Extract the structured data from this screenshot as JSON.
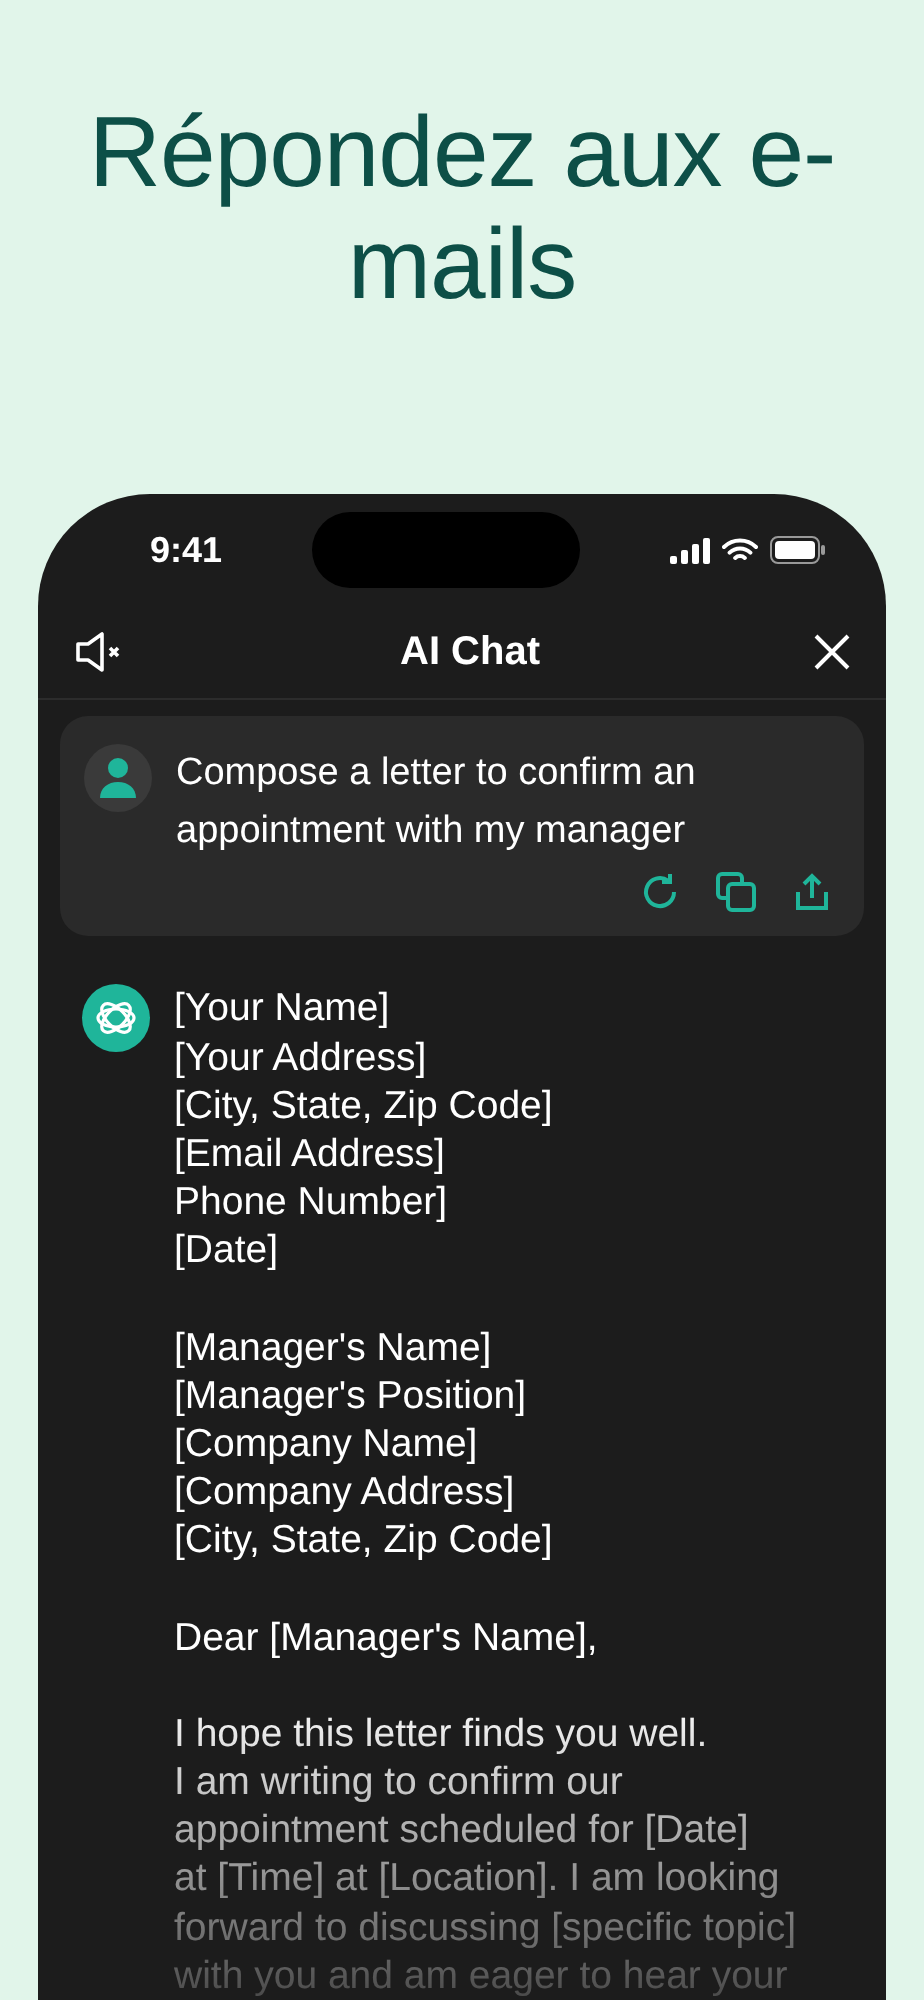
{
  "headline": "Répondez aux e-mails",
  "status_bar": {
    "time": "9:41"
  },
  "header": {
    "title": "AI Chat"
  },
  "user_message": {
    "text": "Compose a letter to confirm an appointment with my manager"
  },
  "assistant_message": {
    "paragraphs": [
      [
        "[Your Name]",
        "[Your Address]",
        "[City, State, Zip Code]",
        "[Email Address]",
        "Phone Number]",
        "[Date]"
      ],
      [
        "[Manager's Name]",
        "[Manager's Position]",
        "[Company Name]",
        "[Company Address]",
        "[City, State, Zip Code]"
      ],
      [
        "Dear [Manager's Name],"
      ],
      [
        "I hope this letter finds you well.",
        "I am writing to confirm our",
        "appointment scheduled for [Date]",
        "at [Time] at [Location]. I am looking",
        "forward to discussing [specific topic]",
        "with you and am eager to hear your"
      ]
    ]
  }
}
